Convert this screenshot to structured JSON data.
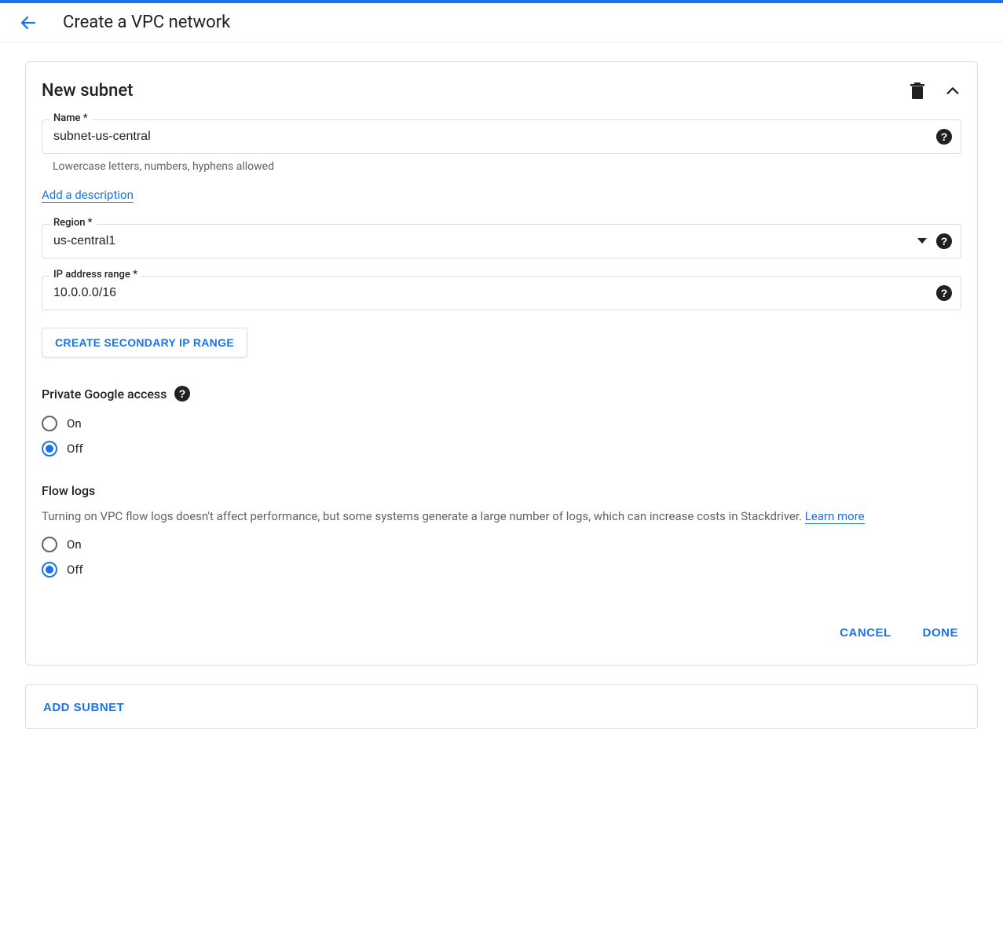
{
  "header": {
    "title": "Create a VPC network"
  },
  "subnet": {
    "card_title": "New subnet",
    "name_label": "Name *",
    "name_value": "subnet-us-central",
    "name_hint": "Lowercase letters, numbers, hyphens allowed",
    "add_description": "Add a description",
    "region_label": "Region *",
    "region_value": "us-central1",
    "ip_range_label": "IP address range *",
    "ip_range_value": "10.0.0.0/16",
    "secondary_ip_btn": "CREATE SECONDARY IP RANGE",
    "pga": {
      "heading": "Private Google access",
      "on": "On",
      "off": "Off"
    },
    "flow_logs": {
      "heading": "Flow logs",
      "desc": "Turning on VPC flow logs doesn't affect performance, but some systems generate a large number of logs, which can increase costs in Stackdriver. ",
      "learn_more": "Learn more",
      "on": "On",
      "off": "Off"
    },
    "cancel": "CANCEL",
    "done": "DONE"
  },
  "add_subnet": "ADD SUBNET"
}
